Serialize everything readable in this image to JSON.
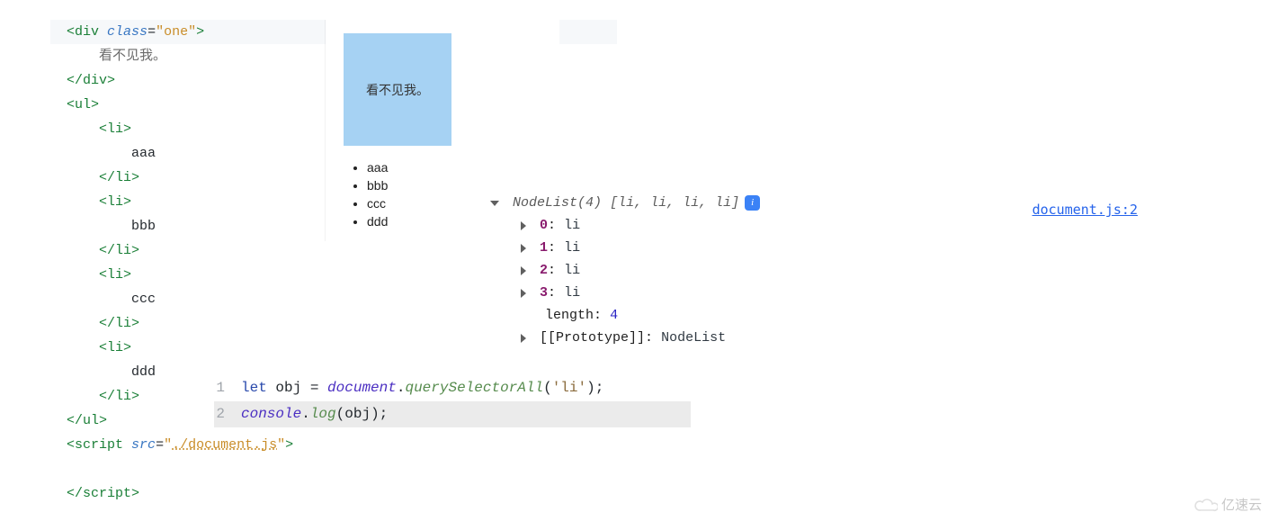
{
  "htmlCode": {
    "div_class": "one",
    "div_text": "看不见我。",
    "li": [
      "aaa",
      "bbb",
      "ccc",
      "ddd"
    ],
    "script_src": "./document.js"
  },
  "render": {
    "box_text": "看不见我。",
    "items": [
      "aaa",
      "bbb",
      "ccc",
      "ddd"
    ]
  },
  "jsSnippet": {
    "lineNumbers": [
      "1",
      "2"
    ],
    "kw_let": "let",
    "var": "obj",
    "doc": "document",
    "method1": "querySelectorAll",
    "arg": "'li'",
    "console": "console",
    "method2": "log",
    "arg2": "obj"
  },
  "console": {
    "header_type": "NodeList",
    "header_count": "(4)",
    "header_items": "[li, li, li, li]",
    "rows": [
      {
        "idx": "0",
        "val": "li"
      },
      {
        "idx": "1",
        "val": "li"
      },
      {
        "idx": "2",
        "val": "li"
      },
      {
        "idx": "3",
        "val": "li"
      }
    ],
    "length_label": "length",
    "length_val": "4",
    "proto_label": "[[Prototype]]",
    "proto_val": "NodeList",
    "source_link": "document.js:2"
  },
  "watermark": "亿速云"
}
